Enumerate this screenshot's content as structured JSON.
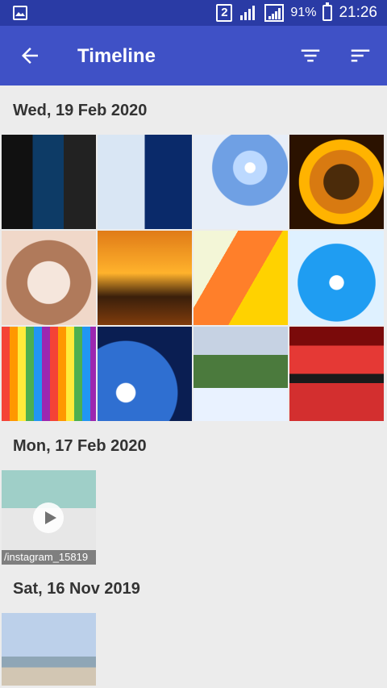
{
  "status_bar": {
    "sim_label": "2",
    "battery": "91%",
    "time": "21:26",
    "icons": [
      "gallery-notification-icon",
      "sim-icon",
      "signal-icon",
      "signal-icon",
      "battery-charging-icon"
    ]
  },
  "app_bar": {
    "title": "Timeline",
    "icons": [
      "back-arrow-icon",
      "filter-icon",
      "sort-icon"
    ]
  },
  "timeline": {
    "groups": [
      {
        "date": "Wed, 19 Feb 2020",
        "thumbnails": [
          {
            "name": "collage-photos"
          },
          {
            "name": "collage-screenshots"
          },
          {
            "name": "space-earth"
          },
          {
            "name": "soccer-ball-fire"
          },
          {
            "name": "puppy"
          },
          {
            "name": "sunset-pier"
          },
          {
            "name": "veggie-cartoon"
          },
          {
            "name": "water-drop-cartoon"
          },
          {
            "name": "colored-pencils"
          },
          {
            "name": "earth-from-space"
          },
          {
            "name": "waterfall-landscape"
          },
          {
            "name": "red-sky-lake"
          }
        ]
      },
      {
        "date": "Mon, 17 Feb 2020",
        "thumbnails": [
          {
            "name": "instagram-video",
            "label": "/instagram_15819",
            "is_video": true
          }
        ]
      },
      {
        "date": "Sat, 16 Nov 2019",
        "thumbnails": [
          {
            "name": "beach-sky"
          }
        ]
      }
    ]
  }
}
